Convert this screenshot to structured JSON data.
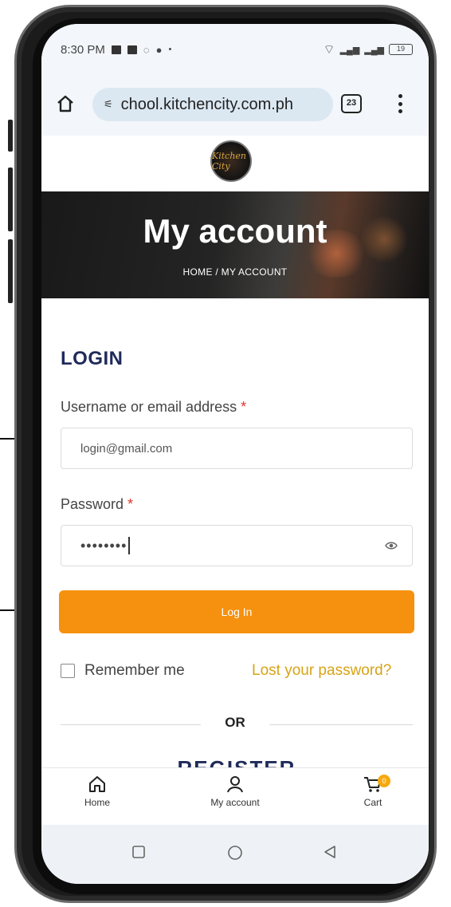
{
  "status_bar": {
    "time": "8:30 PM",
    "battery": "19"
  },
  "browser": {
    "url": "chool.kitchencity.com.ph",
    "tab_count": "23"
  },
  "page": {
    "logo_text": "Kitchen City",
    "hero_title": "My account",
    "breadcrumb": "HOME / MY ACCOUNT",
    "login_heading": "LOGIN",
    "username_label": "Username or email address",
    "required_mark": "*",
    "username_value": "login@gmail.com",
    "password_label": "Password",
    "password_value": "••••••••",
    "login_button": "Log In",
    "remember_label": "Remember me",
    "lost_password": "Lost your password?",
    "or_divider": "OR",
    "register_heading": "REGISTER"
  },
  "bottom_nav": {
    "items": [
      {
        "label": "Home",
        "icon": "home-icon"
      },
      {
        "label": "My account",
        "icon": "user-icon"
      },
      {
        "label": "Cart",
        "icon": "cart-icon"
      }
    ],
    "cart_badge": "0"
  },
  "colors": {
    "accent_orange": "#f6910f",
    "heading_navy": "#1f2a5a",
    "link_gold": "#d7a317"
  }
}
